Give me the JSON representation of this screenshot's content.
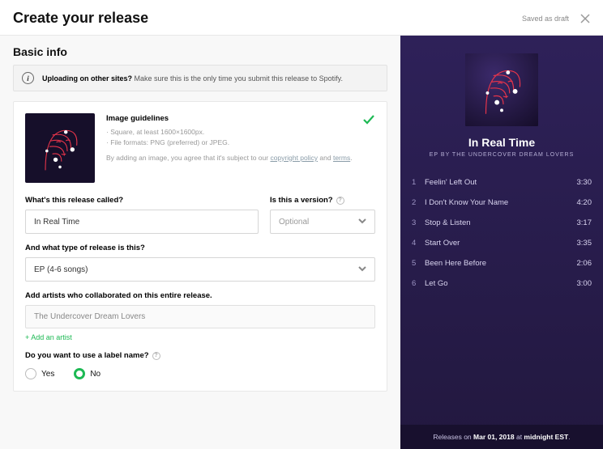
{
  "header": {
    "title": "Create your release",
    "draft_status": "Saved as draft"
  },
  "section_title": "Basic info",
  "banner": {
    "strong": "Uploading on other sites?",
    "rest": " Make sure this is the only time you submit this release to Spotify."
  },
  "guidelines": {
    "title": "Image guidelines",
    "line1": "· Square, at least 1600×1600px.",
    "line2": "· File formats: PNG (preferred) or JPEG.",
    "agree_pre": "By adding an image, you agree that it's subject to our ",
    "copyright_link": "copyright policy",
    "agree_mid": " and ",
    "terms_link": "terms",
    "agree_post": "."
  },
  "fields": {
    "name_label": "What's this release called?",
    "name_value": "In Real Time",
    "version_label": "Is this a version?",
    "version_placeholder": "Optional",
    "type_label": "And what type of release is this?",
    "type_value": "EP (4-6 songs)",
    "collab_label": "Add artists who collaborated on this entire release.",
    "collab_chip": "The Undercover Dream Lovers",
    "add_artist": "+ Add an artist",
    "label_label": "Do you want to use a label name?",
    "radio_yes": "Yes",
    "radio_no": "No"
  },
  "preview": {
    "title": "In Real Time",
    "subtitle": "EP by The Undercover Dream Lovers",
    "tracks": [
      {
        "n": "1",
        "name": "Feelin' Left Out",
        "dur": "3:30"
      },
      {
        "n": "2",
        "name": "I Don't Know Your Name",
        "dur": "4:20"
      },
      {
        "n": "3",
        "name": "Stop & Listen",
        "dur": "3:17"
      },
      {
        "n": "4",
        "name": "Start Over",
        "dur": "3:35"
      },
      {
        "n": "5",
        "name": "Been Here Before",
        "dur": "2:06"
      },
      {
        "n": "6",
        "name": "Let Go",
        "dur": "3:00"
      }
    ],
    "footer_pre": "Releases on ",
    "footer_date": "Mar 01, 2018",
    "footer_mid": " at ",
    "footer_time": "midnight EST",
    "footer_post": "."
  }
}
